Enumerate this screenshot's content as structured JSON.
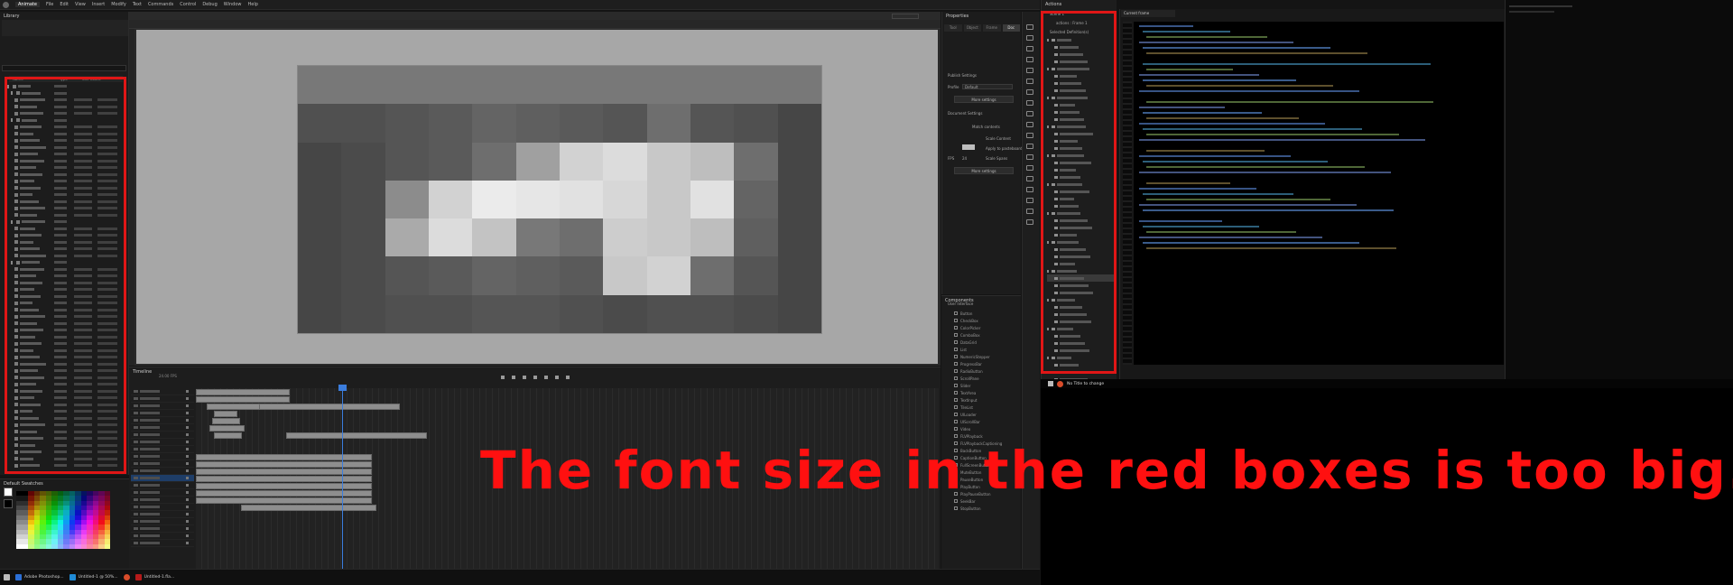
{
  "menubar": {
    "workspace": "Animate",
    "items": [
      "File",
      "Edit",
      "View",
      "Insert",
      "Modify",
      "Text",
      "Commands",
      "Control",
      "Debug",
      "Window",
      "Help"
    ]
  },
  "library": {
    "title": "Library",
    "headers": [
      "Name",
      "Type",
      "Use Count"
    ]
  },
  "swatches": {
    "title": "Default Swatches"
  },
  "timeline": {
    "title": "Timeline",
    "fps": "24.00 FPS"
  },
  "properties": {
    "title": "Properties",
    "tabs": [
      "Tool",
      "Object",
      "Frame",
      "Doc"
    ],
    "publish_settings": "Publish Settings",
    "profile_label": "Profile",
    "profile_value": "Default",
    "more_settings_1": "More settings",
    "document_settings": "Document Settings",
    "match_contents": "Match contents",
    "scale_content": "Scale Content",
    "apply_pasteboard": "Apply to pasteboard",
    "scale_spans": "Scale Spans",
    "fps_label": "FPS",
    "fps_value": "24",
    "more_settings_2": "More settings"
  },
  "components": {
    "title": "Components",
    "group": "User Interface",
    "items": [
      "Button",
      "CheckBox",
      "ColorPicker",
      "ComboBox",
      "DataGrid",
      "List",
      "NumericStepper",
      "ProgressBar",
      "RadioButton",
      "ScrollPane",
      "Slider",
      "TextArea",
      "TextInput",
      "TileList",
      "UILoader",
      "UIScrollBar",
      "Video",
      "FLVPlayback",
      "FLVPlaybackCaptioning",
      "BackButton",
      "CaptionButton",
      "FullScreenButton",
      "MuteButton",
      "PauseButton",
      "PlayButton",
      "PlayPauseButton",
      "SeekBar",
      "StopButton"
    ]
  },
  "outline": {
    "title": "Actions",
    "scene": "Scene 1",
    "frame": "actions : Frame 1",
    "selected": "Selected Definition(s)"
  },
  "code": {
    "tab": "Current frame"
  },
  "taskbar": {
    "items": [
      "Adobe Photoshop...",
      "Untitled-1 @ 50%...",
      "",
      "Untitled-1.fla..."
    ]
  },
  "taskbar2": {
    "item": "No Title to change"
  },
  "annotation": "The font size in the red boxes is too big.",
  "colors": {
    "red": "#e01616",
    "accent": "#3b7ddd"
  }
}
